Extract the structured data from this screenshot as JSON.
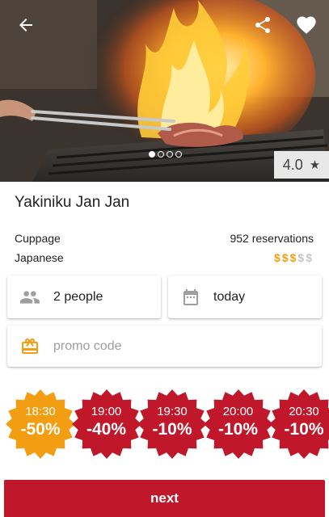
{
  "header": {
    "back_icon": "arrow-back-icon",
    "share_icon": "share-icon",
    "favorite_icon": "heart-icon",
    "photo_count": 4,
    "active_photo": 1
  },
  "restaurant": {
    "rating": "4.0",
    "rating_icon": "star-icon",
    "name": "Yakiniku Jan Jan",
    "area": "Cuppage",
    "cuisine": "Japanese",
    "reservations": "952 reservations",
    "price_level": 3,
    "price_max": 5,
    "price_symbol": "$"
  },
  "booking": {
    "people_icon": "people-icon",
    "people": "2 people",
    "date_icon": "calendar-icon",
    "date": "today",
    "promo_icon": "gift-icon",
    "promo_placeholder": "promo code"
  },
  "timeslots": [
    {
      "time": "18:30",
      "discount": "-50%",
      "color": "#f29d12"
    },
    {
      "time": "19:00",
      "discount": "-40%",
      "color": "#c0182a"
    },
    {
      "time": "19:30",
      "discount": "-10%",
      "color": "#c0182a"
    },
    {
      "time": "20:00",
      "discount": "-10%",
      "color": "#c0182a"
    },
    {
      "time": "20:30",
      "discount": "-10%",
      "color": "#c0182a"
    }
  ],
  "action": {
    "next_label": "next"
  },
  "colors": {
    "accent": "#c0182a",
    "highlight": "#f29d12",
    "price_on": "#f29d12",
    "price_off": "#c6c6c6"
  }
}
